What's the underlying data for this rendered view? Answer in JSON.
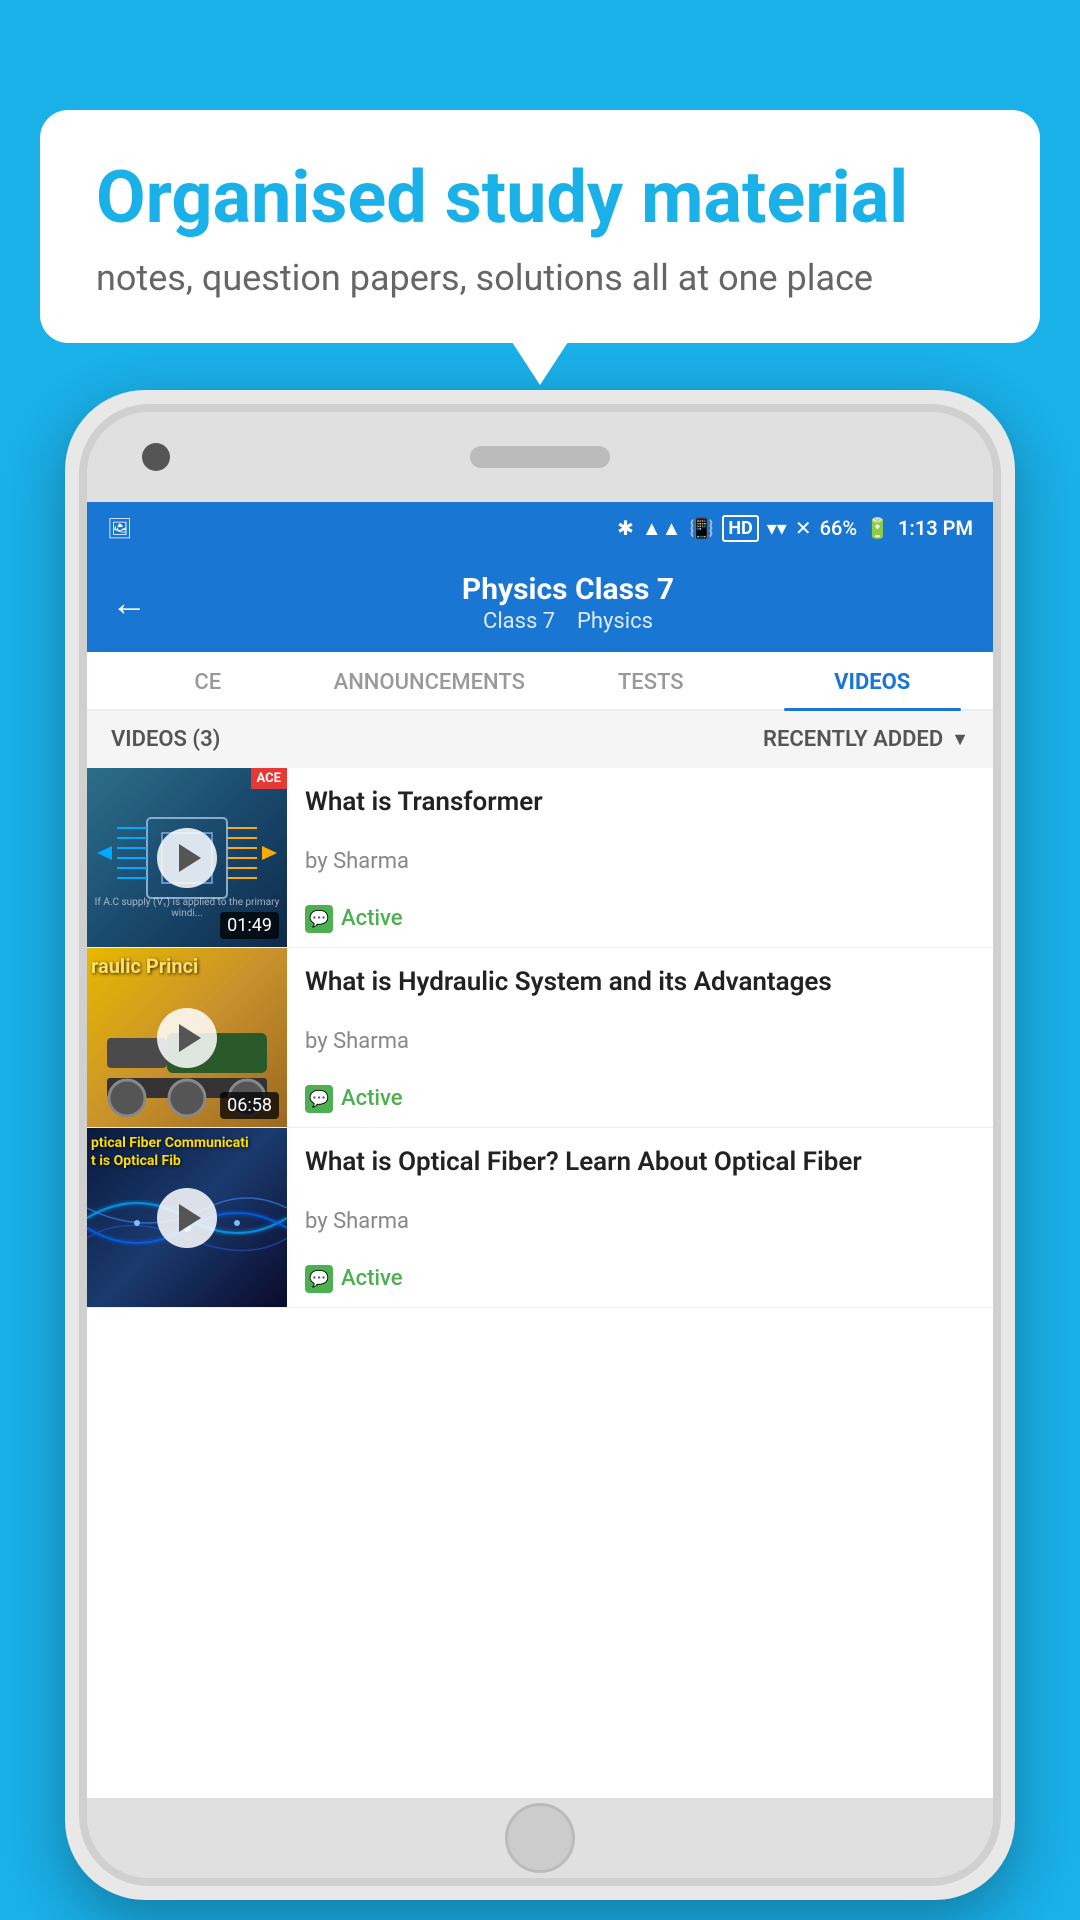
{
  "background_color": "#1ab0e8",
  "speech_bubble": {
    "title": "Organised study material",
    "subtitle": "notes, question papers, solutions all at one place"
  },
  "status_bar": {
    "time": "1:13 PM",
    "battery": "66%",
    "icons": [
      "bluetooth",
      "signal",
      "vibrate",
      "hd",
      "wifi",
      "network"
    ]
  },
  "app_bar": {
    "back_label": "←",
    "main_title": "Physics Class 7",
    "subtitle_class": "Class 7",
    "subtitle_subject": "Physics"
  },
  "tabs": [
    {
      "id": "ce",
      "label": "CE",
      "active": false
    },
    {
      "id": "announcements",
      "label": "ANNOUNCEMENTS",
      "active": false
    },
    {
      "id": "tests",
      "label": "TESTS",
      "active": false
    },
    {
      "id": "videos",
      "label": "VIDEOS",
      "active": true
    }
  ],
  "filter_bar": {
    "count_label": "VIDEOS (3)",
    "sort_label": "RECENTLY ADDED"
  },
  "videos": [
    {
      "id": "v1",
      "title": "What is  Transformer",
      "author": "by Sharma",
      "status": "Active",
      "duration": "01:49",
      "thumbnail_type": "transformer",
      "thumbnail_text": "If A.C supply (V₁) is applied to the primary windi..."
    },
    {
      "id": "v2",
      "title": "What is Hydraulic System and its Advantages",
      "author": "by Sharma",
      "status": "Active",
      "duration": "06:58",
      "thumbnail_type": "hydraulic",
      "thumbnail_label": "raulic Princi"
    },
    {
      "id": "v3",
      "title": "What is Optical Fiber? Learn About Optical Fiber",
      "author": "by Sharma",
      "status": "Active",
      "duration": "",
      "thumbnail_type": "optical",
      "thumbnail_label_line1": "ptical Fiber Communicati",
      "thumbnail_label_line2": "t is Optical Fib"
    }
  ]
}
